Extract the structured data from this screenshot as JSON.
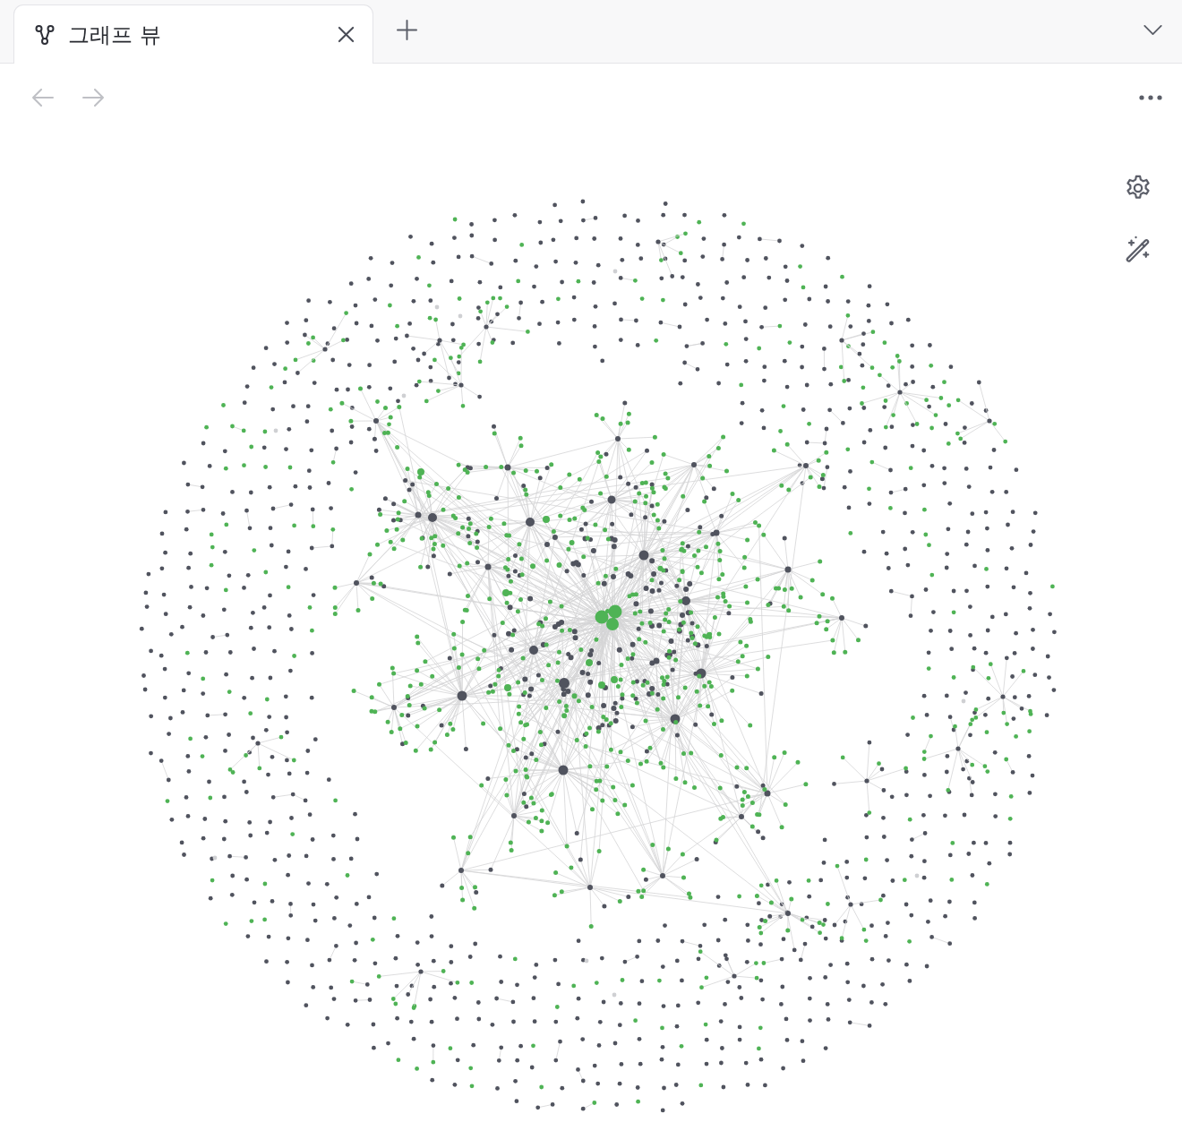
{
  "tabs": [
    {
      "label": "그래프 뷰",
      "selected": true
    }
  ],
  "navigation": {
    "back": {
      "disabled": true
    },
    "forward": {
      "disabled": true
    }
  }
}
